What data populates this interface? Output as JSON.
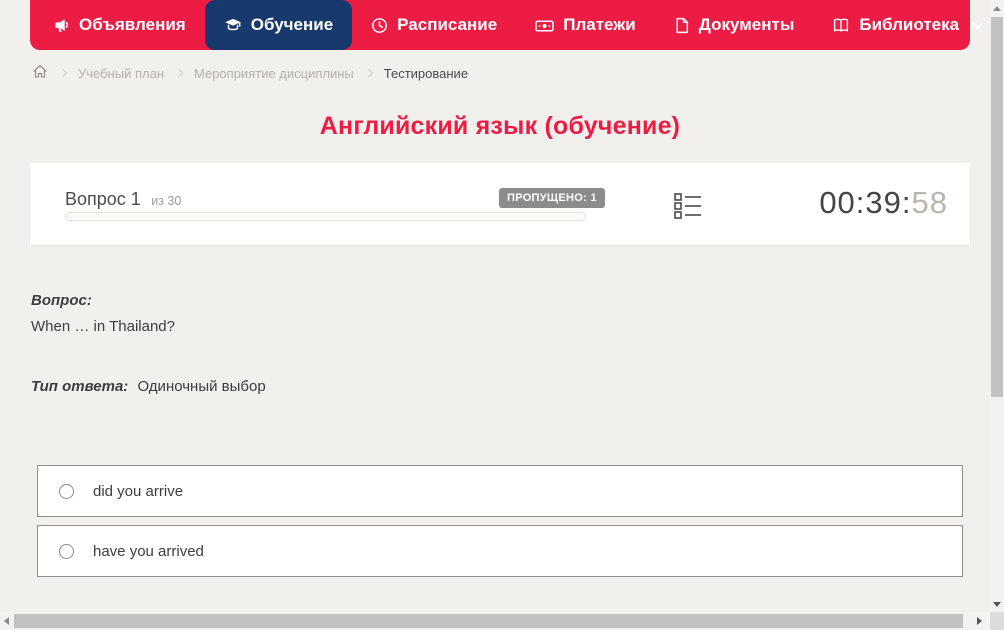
{
  "nav": {
    "items": [
      {
        "label": "Объявления",
        "icon": "megaphone-icon"
      },
      {
        "label": "Обучение",
        "icon": "graduation-cap-icon"
      },
      {
        "label": "Расписание",
        "icon": "clock-icon"
      },
      {
        "label": "Платежи",
        "icon": "cash-icon"
      },
      {
        "label": "Документы",
        "icon": "document-icon"
      },
      {
        "label": "Библиотека",
        "icon": "book-icon"
      }
    ],
    "colors": {
      "bar": "#ed1c45",
      "active_tab": "#17396b"
    }
  },
  "breadcrumb": {
    "items": [
      "Учебный план",
      "Мероприятие дисциплины",
      "Тестирование"
    ]
  },
  "page": {
    "title": "Английский язык (обучение)",
    "title_color": "#ed1c45"
  },
  "test_header": {
    "question_label": "Вопрос 1",
    "question_of": "из 30",
    "skipped_badge": "ПРОПУЩЕНО: 1",
    "progress_percent": 0,
    "timer_main": "00:39:",
    "timer_seconds": "58"
  },
  "question": {
    "label": "Вопрос:",
    "text": "When … in Thailand?",
    "answer_type_label": "Тип ответа:",
    "answer_type_value": "Одиночный выбор",
    "options": [
      {
        "label": "did you arrive",
        "selected": false
      },
      {
        "label": "have you arrived",
        "selected": false
      }
    ]
  }
}
